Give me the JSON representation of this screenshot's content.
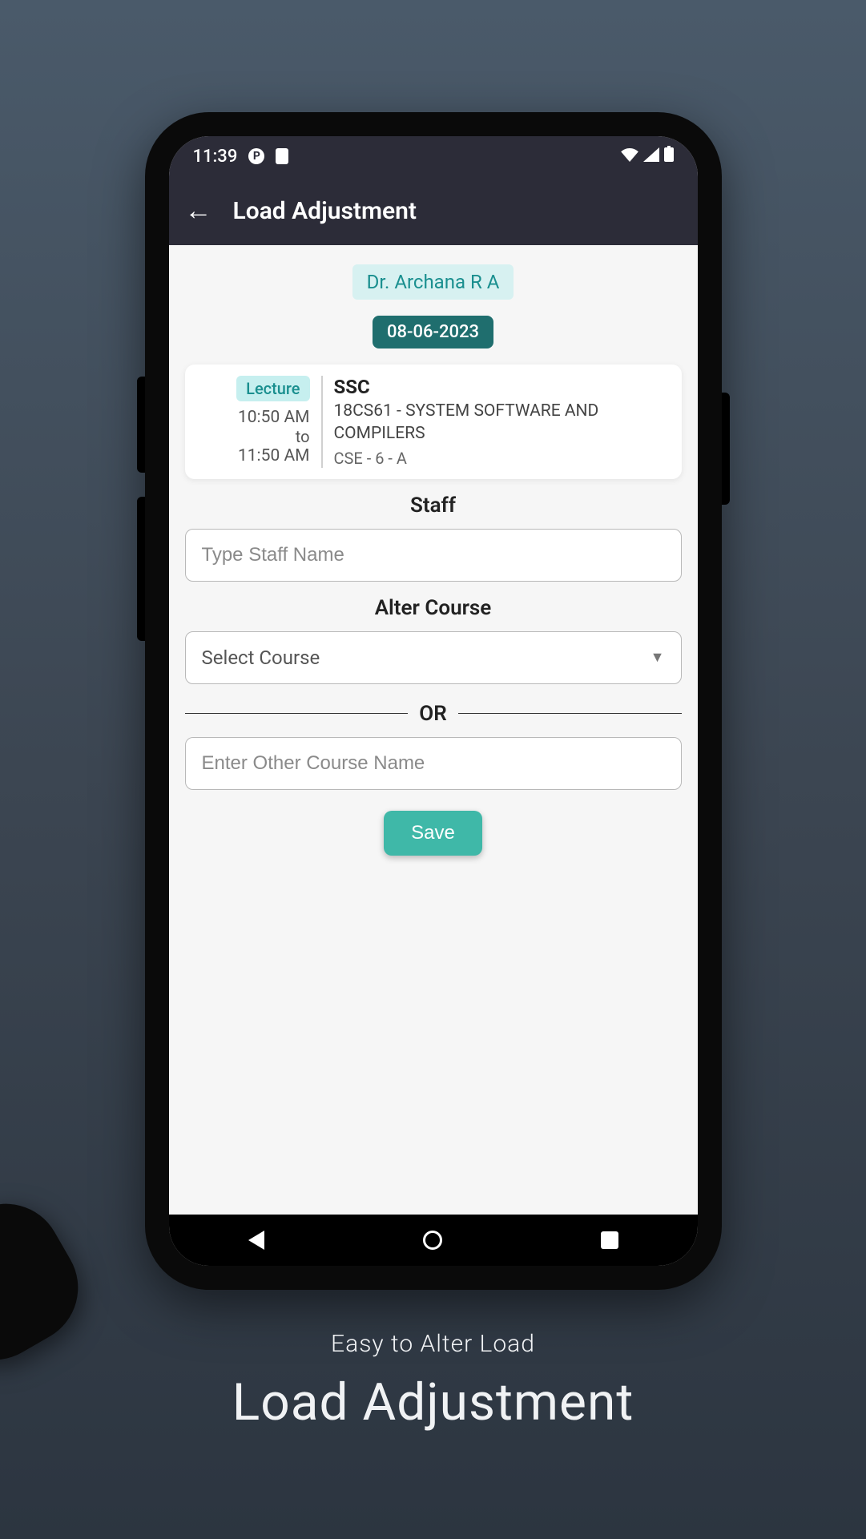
{
  "status_bar": {
    "time": "11:39"
  },
  "header": {
    "title": "Load Adjustment"
  },
  "staff_name": "Dr. Archana R A",
  "date": "08-06-2023",
  "lecture": {
    "type_badge": "Lecture",
    "start_time": "10:50 AM",
    "to_label": "to",
    "end_time": "11:50 AM",
    "short_code": "SSC",
    "course_full": "18CS61 - SYSTEM SOFTWARE AND COMPILERS",
    "section": "CSE - 6 - A"
  },
  "labels": {
    "staff": "Staff",
    "alter_course": "Alter Course",
    "or": "OR"
  },
  "inputs": {
    "staff_placeholder": "Type Staff Name",
    "select_course_placeholder": "Select Course",
    "other_course_placeholder": "Enter Other Course Name"
  },
  "buttons": {
    "save": "Save"
  },
  "promo": {
    "subtitle": "Easy to Alter  Load",
    "title": "Load Adjustment"
  }
}
